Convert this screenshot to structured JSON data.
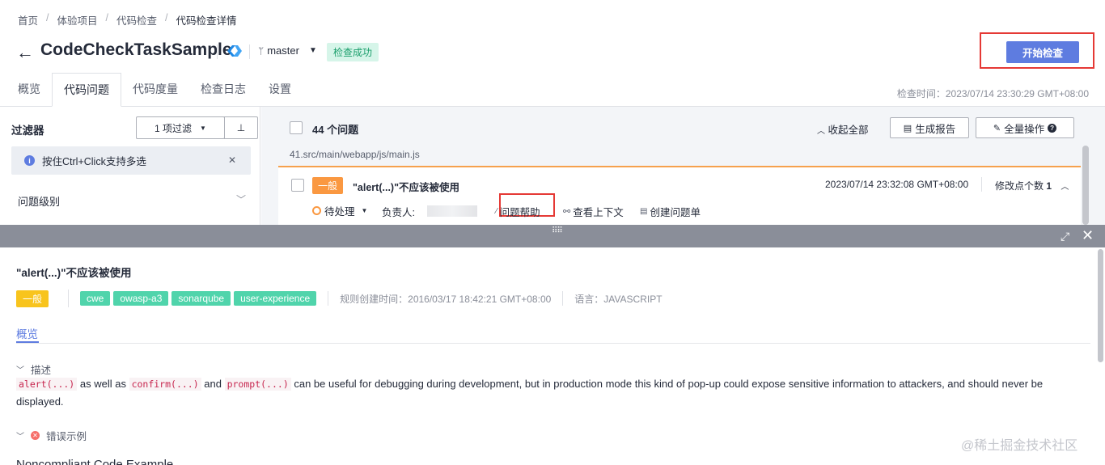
{
  "breadcrumb": [
    "首页",
    "体验项目",
    "代码检查",
    "代码检查详情"
  ],
  "header": {
    "title": "CodeCheckTaskSample",
    "branch": "master",
    "status_badge": "检查成功",
    "start_button": "开始检查",
    "check_time": "检查时间：2023/07/14 23:30:29 GMT+08:00"
  },
  "tabs": [
    "概览",
    "代码问题",
    "代码度量",
    "检查日志",
    "设置"
  ],
  "filter": {
    "title": "过滤器",
    "select_value": "1 项过滤",
    "tip": "按住Ctrl+Click支持多选",
    "level_label": "问题级别"
  },
  "issues": {
    "count_label": "44 个问题",
    "collapse_all": "收起全部",
    "generate_report": "生成报告",
    "all_actions": "全量操作",
    "file_path": "41.src/main/webapp/js/main.js",
    "card": {
      "level": "一般",
      "title": "\"alert(...)\"不应该被使用",
      "time": "2023/07/14 23:32:08 GMT+08:00",
      "modify_label": "修改点个数",
      "modify_count": "1",
      "status": "待处理",
      "owner_label": "负责人:",
      "help": "问题帮助",
      "context": "查看上下文",
      "create_ticket": "创建问题单"
    }
  },
  "detail": {
    "title": "\"alert(...)\"不应该被使用",
    "level": "一般",
    "tags": [
      "cwe",
      "owasp-a3",
      "sonarqube",
      "user-experience"
    ],
    "rule_time": "规则创建时间：2016/03/17 18:42:21 GMT+08:00",
    "language": "语言：JAVASCRIPT",
    "tab": "概览",
    "desc_head": "描述",
    "desc": {
      "code1": "alert(...)",
      "t1": " as well as ",
      "code2": "confirm(...)",
      "t2": " and ",
      "code3": "prompt(...)",
      "t3": " can be useful for debugging during development, but in production mode this kind of pop-up could expose sensitive information to attackers, and should never be displayed."
    },
    "error_head": "错误示例",
    "noncompliant": "Noncompliant Code Example"
  },
  "watermark": "@稀土掘金技术社区"
}
